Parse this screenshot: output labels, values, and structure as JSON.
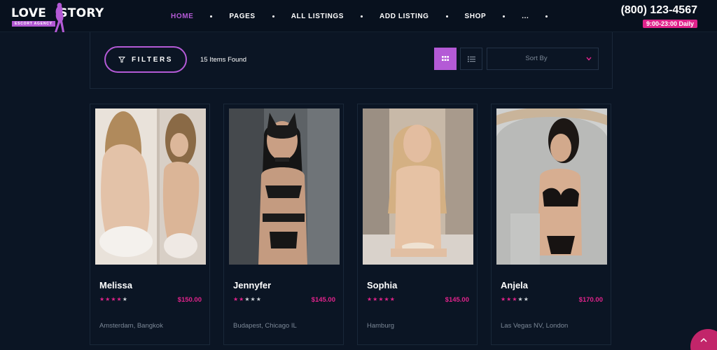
{
  "brand": {
    "name_left": "LOVE",
    "name_right": "STORY",
    "tagline": "ESCORT AGENCY",
    "accent": "#b45ad6",
    "pink": "#e0238b"
  },
  "nav": {
    "items": [
      {
        "label": "HOME",
        "active": true
      },
      {
        "label": "PAGES",
        "active": false
      },
      {
        "label": "ALL LISTINGS",
        "active": false
      },
      {
        "label": "ADD LISTING",
        "active": false
      },
      {
        "label": "SHOP",
        "active": false
      },
      {
        "label": "...",
        "active": false
      }
    ]
  },
  "contact": {
    "phone": "(800) 123-4567",
    "hours": "9:00-23:00 Daily"
  },
  "toolbar": {
    "filters_label": "FILTERS",
    "items_found": "15 Items Found",
    "view_mode": "grid",
    "sort_label": "Sort By",
    "icons": [
      "funnel-icon",
      "grid-view-icon",
      "list-view-icon",
      "chevron-down-icon"
    ]
  },
  "listings": [
    {
      "name": "Melissa",
      "rating": 4,
      "price": "$150.00",
      "location": "Amsterdam, Bangkok"
    },
    {
      "name": "Jennyfer",
      "rating": 2,
      "price": "$145.00",
      "location": "Budapest, Chicago IL"
    },
    {
      "name": "Sophia",
      "rating": 5,
      "price": "$145.00",
      "location": "Hamburg"
    },
    {
      "name": "Anjela",
      "rating": 3,
      "price": "$170.00",
      "location": "Las Vegas NV, London"
    }
  ],
  "scroll_top_icon": "chevron-up-icon"
}
